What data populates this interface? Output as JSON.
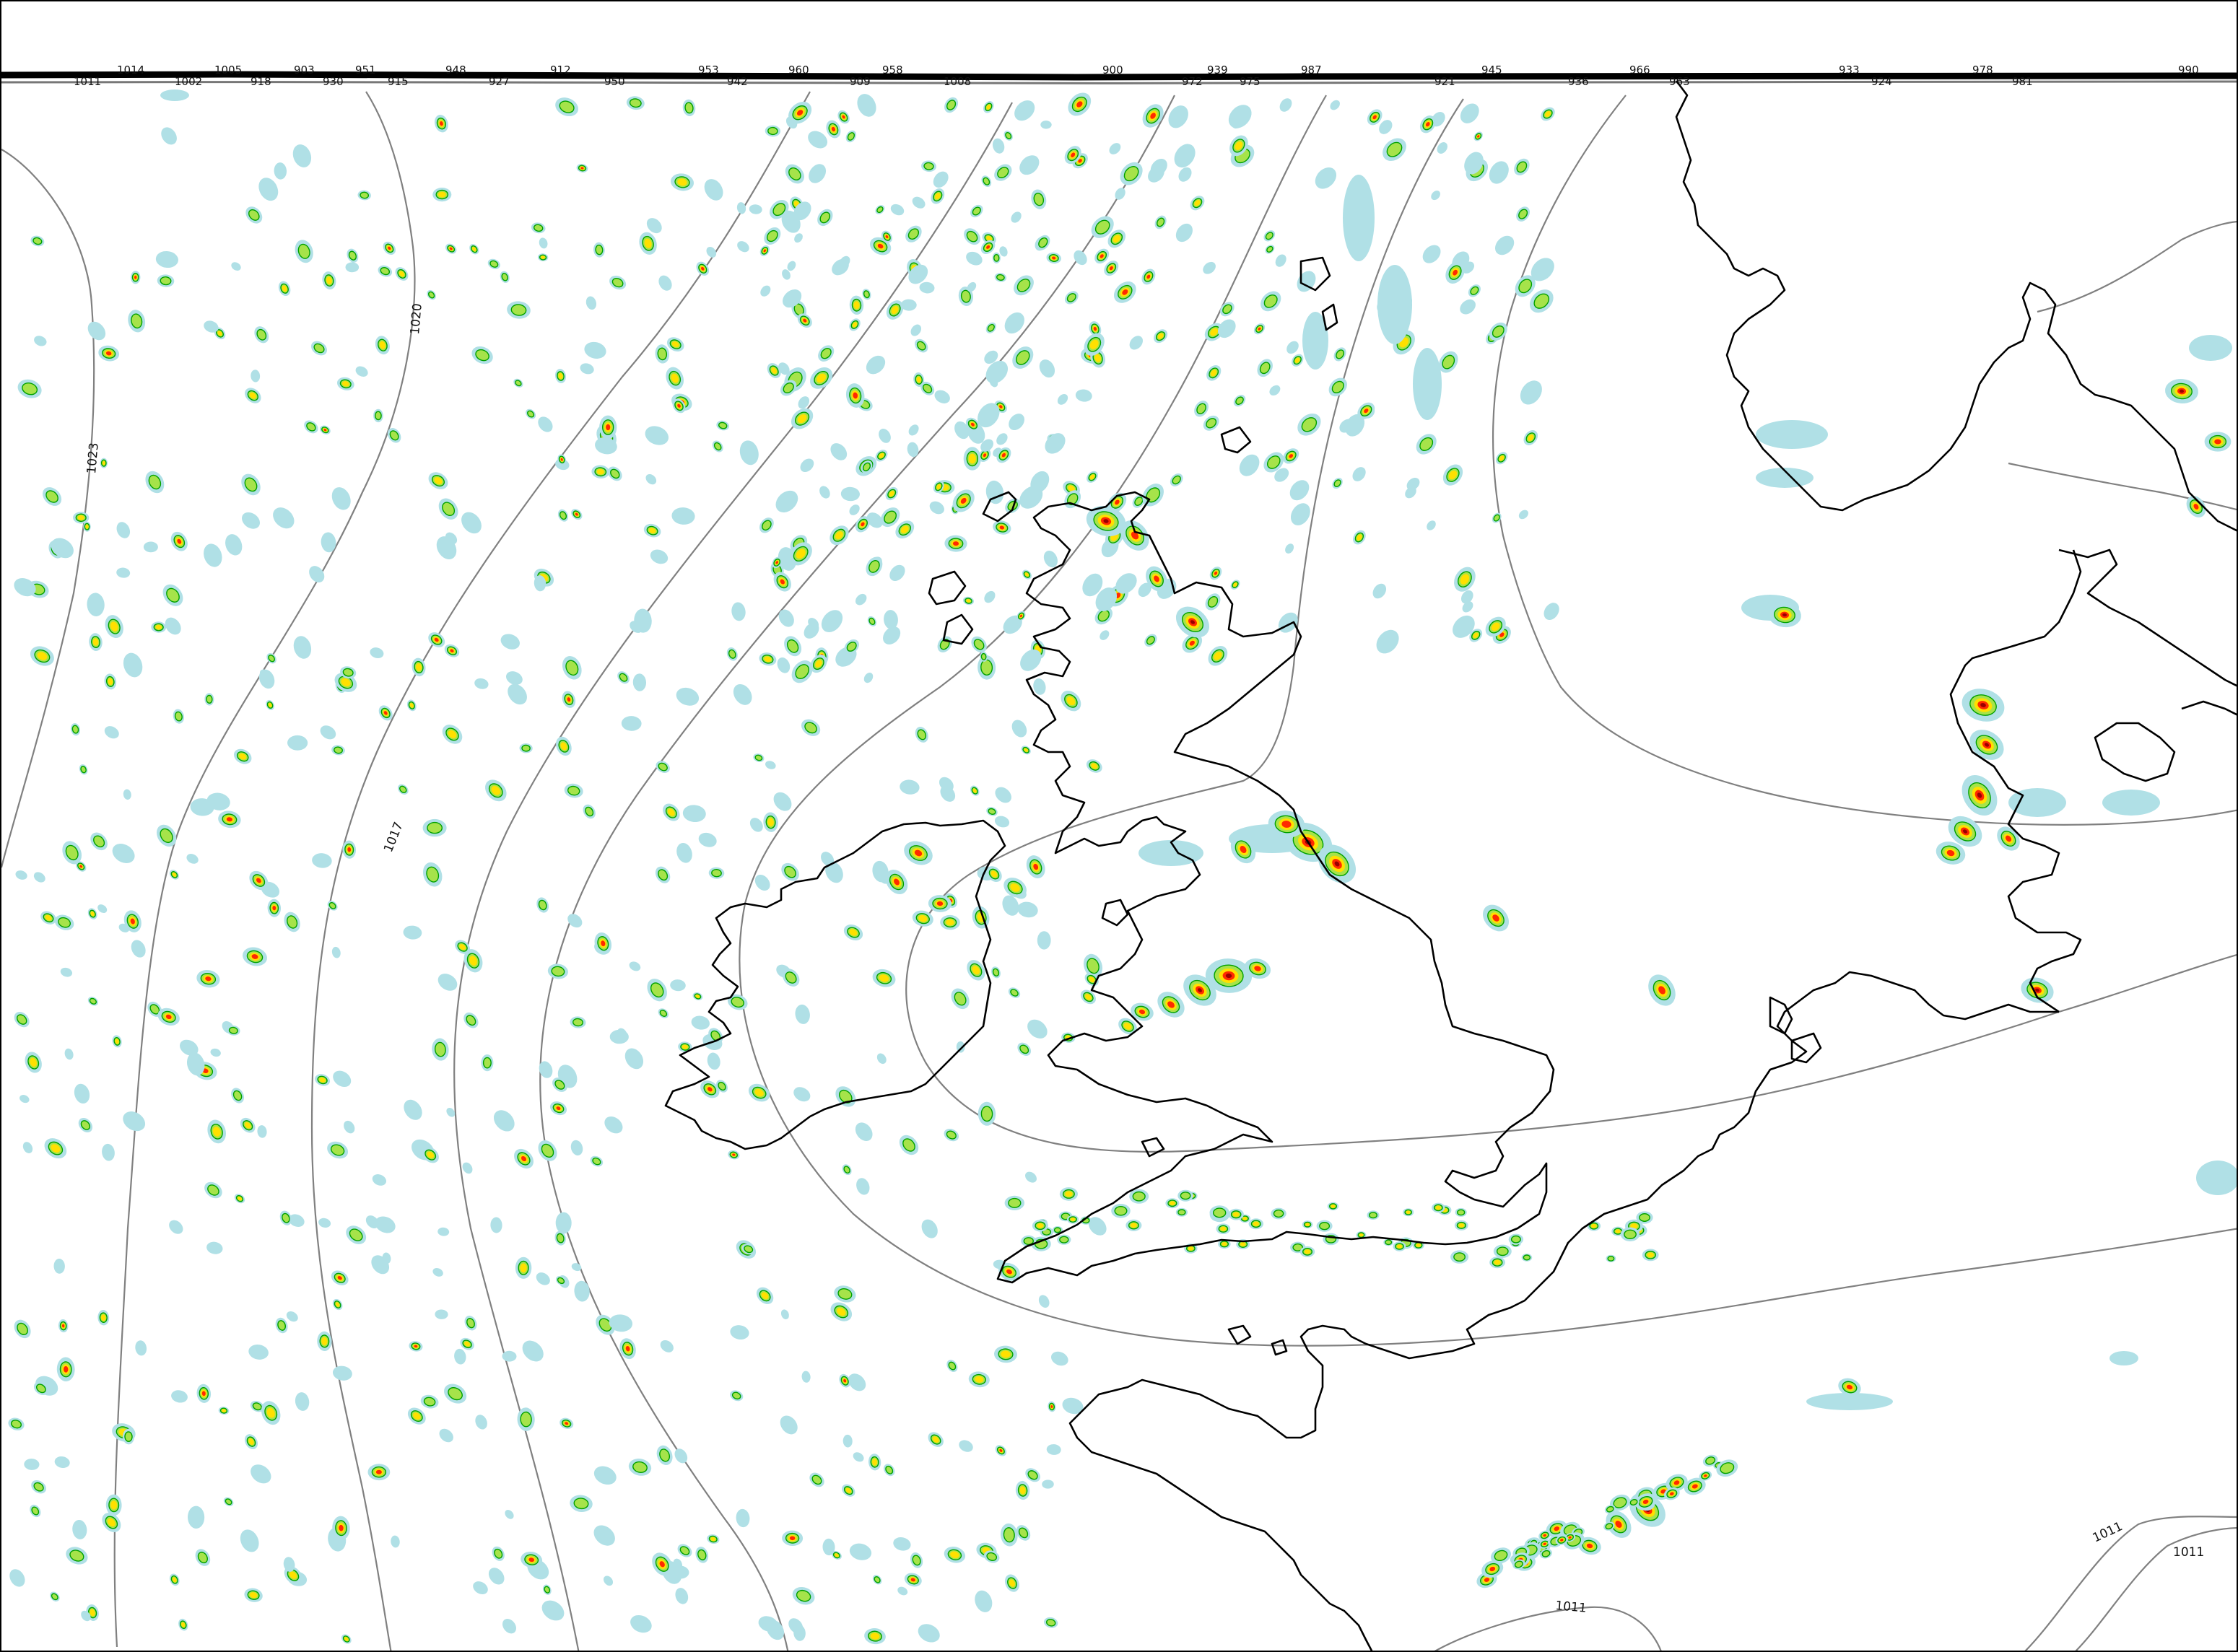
{
  "map": {
    "colors": {
      "light_precip": "#b0e0e6",
      "moderate_precip": "#a6e34a",
      "heavy_precip": "#ffe000",
      "very_heavy_precip": "#ff2a00",
      "extreme_precip": "#9b0000",
      "contour_edge": "#00a000",
      "coastline": "#000000",
      "isobar": "#808080"
    },
    "isobar_labels": [
      "1023",
      "1020",
      "1017",
      "1011",
      "1011",
      "1011"
    ],
    "top_band_labels": [
      "1011",
      "1014",
      "1002",
      "1005",
      "918",
      "903",
      "930",
      "951",
      "915",
      "948",
      "927",
      "912",
      "950",
      "953",
      "942",
      "960",
      "909",
      "958",
      "1008",
      "900",
      "972",
      "939",
      "975",
      "987",
      "921",
      "945",
      "936",
      "966",
      "963",
      "933",
      "924",
      "978",
      "981",
      "990"
    ]
  }
}
